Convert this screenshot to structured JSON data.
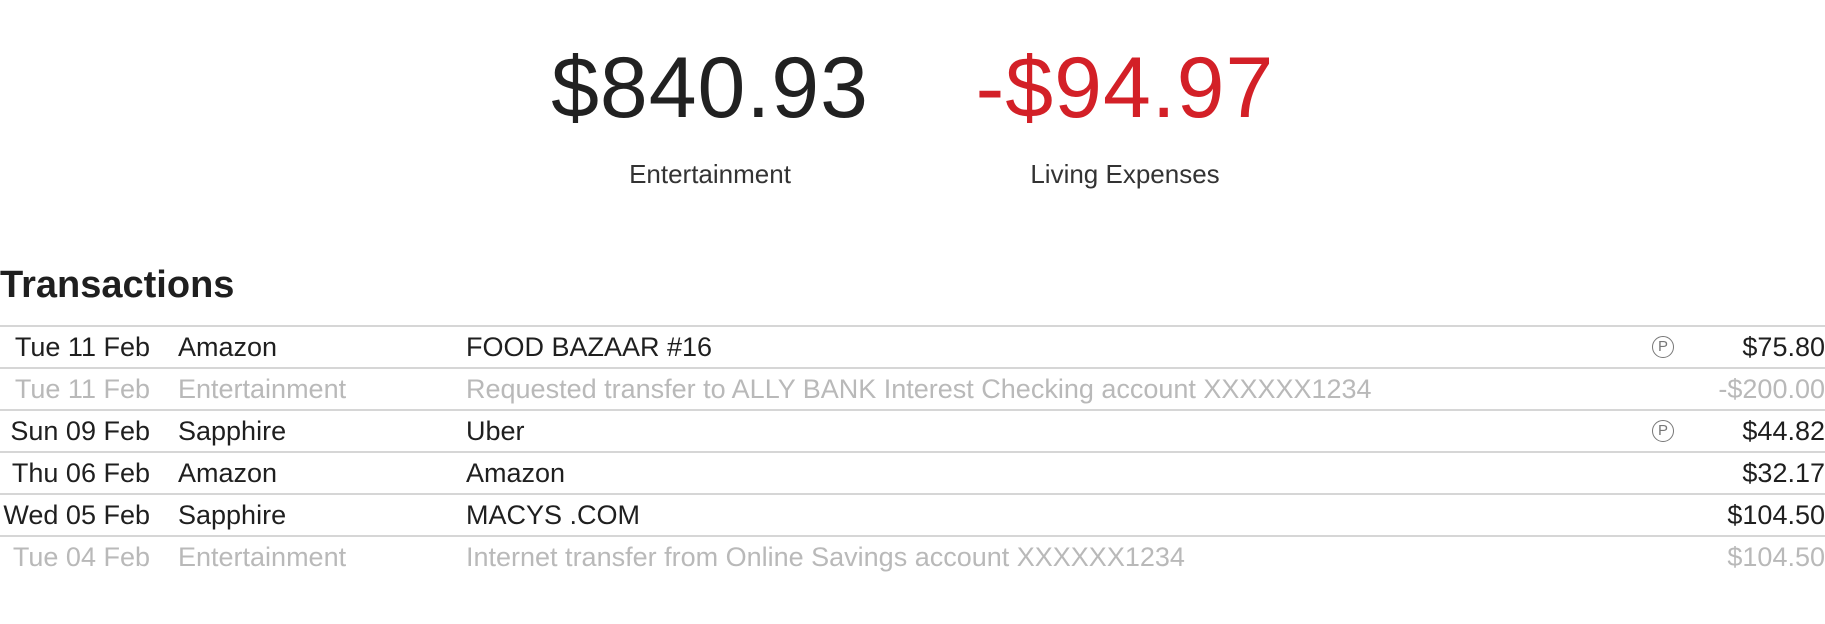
{
  "summary": {
    "entertainment": {
      "value": "$840.93",
      "label": "Entertainment"
    },
    "living": {
      "value": "-$94.97",
      "label": "Living Expenses"
    }
  },
  "colors": {
    "negative": "#d32027",
    "muted_text": "#b9b9b9",
    "divider": "#d6d6d6"
  },
  "transactions": {
    "title": "Transactions",
    "pending_icon": "pending-circle-p-icon",
    "rows": [
      {
        "date": "Tue 11 Feb",
        "account": "Amazon",
        "description": "FOOD BAZAAR #16",
        "pending": "P",
        "amount": "$75.80"
      },
      {
        "date": "Tue 11 Feb",
        "account": "Entertainment",
        "description": "Requested transfer to ALLY BANK Interest Checking account XXXXXX1234",
        "pending": "",
        "amount": "-$200.00"
      },
      {
        "date": "Sun 09 Feb",
        "account": "Sapphire",
        "description": "Uber",
        "pending": "P",
        "amount": "$44.82"
      },
      {
        "date": "Thu 06 Feb",
        "account": "Amazon",
        "description": "Amazon",
        "pending": "",
        "amount": "$32.17"
      },
      {
        "date": "Wed 05 Feb",
        "account": "Sapphire",
        "description": "MACYS .COM",
        "pending": "",
        "amount": "$104.50"
      },
      {
        "date": "Tue 04 Feb",
        "account": "Entertainment",
        "description": "Internet transfer from Online Savings account XXXXXX1234",
        "pending": "",
        "amount": "$104.50"
      }
    ]
  }
}
